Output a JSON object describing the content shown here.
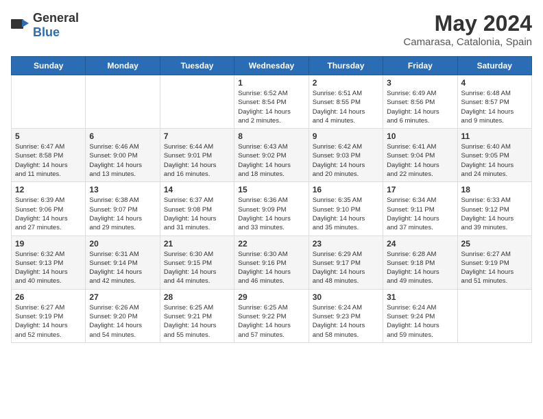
{
  "header": {
    "logo_general": "General",
    "logo_blue": "Blue",
    "month": "May 2024",
    "location": "Camarasa, Catalonia, Spain"
  },
  "weekdays": [
    "Sunday",
    "Monday",
    "Tuesday",
    "Wednesday",
    "Thursday",
    "Friday",
    "Saturday"
  ],
  "rows": [
    {
      "cells": [
        {
          "day": "",
          "info": ""
        },
        {
          "day": "",
          "info": ""
        },
        {
          "day": "",
          "info": ""
        },
        {
          "day": "1",
          "info": "Sunrise: 6:52 AM\nSunset: 8:54 PM\nDaylight: 14 hours\nand 2 minutes."
        },
        {
          "day": "2",
          "info": "Sunrise: 6:51 AM\nSunset: 8:55 PM\nDaylight: 14 hours\nand 4 minutes."
        },
        {
          "day": "3",
          "info": "Sunrise: 6:49 AM\nSunset: 8:56 PM\nDaylight: 14 hours\nand 6 minutes."
        },
        {
          "day": "4",
          "info": "Sunrise: 6:48 AM\nSunset: 8:57 PM\nDaylight: 14 hours\nand 9 minutes."
        }
      ]
    },
    {
      "cells": [
        {
          "day": "5",
          "info": "Sunrise: 6:47 AM\nSunset: 8:58 PM\nDaylight: 14 hours\nand 11 minutes."
        },
        {
          "day": "6",
          "info": "Sunrise: 6:46 AM\nSunset: 9:00 PM\nDaylight: 14 hours\nand 13 minutes."
        },
        {
          "day": "7",
          "info": "Sunrise: 6:44 AM\nSunset: 9:01 PM\nDaylight: 14 hours\nand 16 minutes."
        },
        {
          "day": "8",
          "info": "Sunrise: 6:43 AM\nSunset: 9:02 PM\nDaylight: 14 hours\nand 18 minutes."
        },
        {
          "day": "9",
          "info": "Sunrise: 6:42 AM\nSunset: 9:03 PM\nDaylight: 14 hours\nand 20 minutes."
        },
        {
          "day": "10",
          "info": "Sunrise: 6:41 AM\nSunset: 9:04 PM\nDaylight: 14 hours\nand 22 minutes."
        },
        {
          "day": "11",
          "info": "Sunrise: 6:40 AM\nSunset: 9:05 PM\nDaylight: 14 hours\nand 24 minutes."
        }
      ]
    },
    {
      "cells": [
        {
          "day": "12",
          "info": "Sunrise: 6:39 AM\nSunset: 9:06 PM\nDaylight: 14 hours\nand 27 minutes."
        },
        {
          "day": "13",
          "info": "Sunrise: 6:38 AM\nSunset: 9:07 PM\nDaylight: 14 hours\nand 29 minutes."
        },
        {
          "day": "14",
          "info": "Sunrise: 6:37 AM\nSunset: 9:08 PM\nDaylight: 14 hours\nand 31 minutes."
        },
        {
          "day": "15",
          "info": "Sunrise: 6:36 AM\nSunset: 9:09 PM\nDaylight: 14 hours\nand 33 minutes."
        },
        {
          "day": "16",
          "info": "Sunrise: 6:35 AM\nSunset: 9:10 PM\nDaylight: 14 hours\nand 35 minutes."
        },
        {
          "day": "17",
          "info": "Sunrise: 6:34 AM\nSunset: 9:11 PM\nDaylight: 14 hours\nand 37 minutes."
        },
        {
          "day": "18",
          "info": "Sunrise: 6:33 AM\nSunset: 9:12 PM\nDaylight: 14 hours\nand 39 minutes."
        }
      ]
    },
    {
      "cells": [
        {
          "day": "19",
          "info": "Sunrise: 6:32 AM\nSunset: 9:13 PM\nDaylight: 14 hours\nand 40 minutes."
        },
        {
          "day": "20",
          "info": "Sunrise: 6:31 AM\nSunset: 9:14 PM\nDaylight: 14 hours\nand 42 minutes."
        },
        {
          "day": "21",
          "info": "Sunrise: 6:30 AM\nSunset: 9:15 PM\nDaylight: 14 hours\nand 44 minutes."
        },
        {
          "day": "22",
          "info": "Sunrise: 6:30 AM\nSunset: 9:16 PM\nDaylight: 14 hours\nand 46 minutes."
        },
        {
          "day": "23",
          "info": "Sunrise: 6:29 AM\nSunset: 9:17 PM\nDaylight: 14 hours\nand 48 minutes."
        },
        {
          "day": "24",
          "info": "Sunrise: 6:28 AM\nSunset: 9:18 PM\nDaylight: 14 hours\nand 49 minutes."
        },
        {
          "day": "25",
          "info": "Sunrise: 6:27 AM\nSunset: 9:19 PM\nDaylight: 14 hours\nand 51 minutes."
        }
      ]
    },
    {
      "cells": [
        {
          "day": "26",
          "info": "Sunrise: 6:27 AM\nSunset: 9:19 PM\nDaylight: 14 hours\nand 52 minutes."
        },
        {
          "day": "27",
          "info": "Sunrise: 6:26 AM\nSunset: 9:20 PM\nDaylight: 14 hours\nand 54 minutes."
        },
        {
          "day": "28",
          "info": "Sunrise: 6:25 AM\nSunset: 9:21 PM\nDaylight: 14 hours\nand 55 minutes."
        },
        {
          "day": "29",
          "info": "Sunrise: 6:25 AM\nSunset: 9:22 PM\nDaylight: 14 hours\nand 57 minutes."
        },
        {
          "day": "30",
          "info": "Sunrise: 6:24 AM\nSunset: 9:23 PM\nDaylight: 14 hours\nand 58 minutes."
        },
        {
          "day": "31",
          "info": "Sunrise: 6:24 AM\nSunset: 9:24 PM\nDaylight: 14 hours\nand 59 minutes."
        },
        {
          "day": "",
          "info": ""
        }
      ]
    }
  ]
}
